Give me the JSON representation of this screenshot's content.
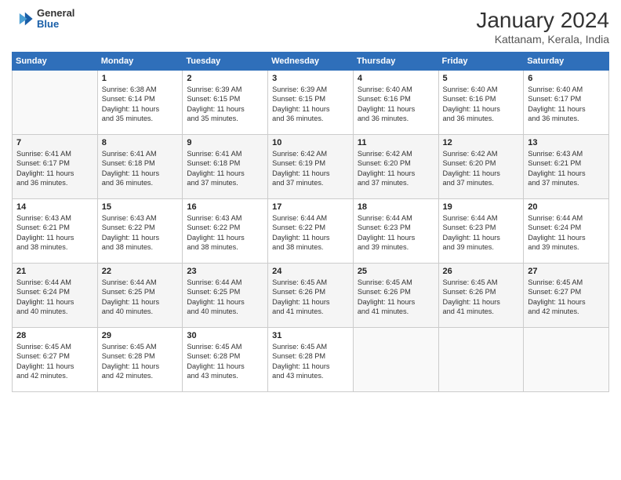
{
  "header": {
    "logo_general": "General",
    "logo_blue": "Blue",
    "month_title": "January 2024",
    "subtitle": "Kattanam, Kerala, India"
  },
  "weekdays": [
    "Sunday",
    "Monday",
    "Tuesday",
    "Wednesday",
    "Thursday",
    "Friday",
    "Saturday"
  ],
  "weeks": [
    [
      {
        "day": "",
        "info": ""
      },
      {
        "day": "1",
        "info": "Sunrise: 6:38 AM\nSunset: 6:14 PM\nDaylight: 11 hours\nand 35 minutes."
      },
      {
        "day": "2",
        "info": "Sunrise: 6:39 AM\nSunset: 6:15 PM\nDaylight: 11 hours\nand 35 minutes."
      },
      {
        "day": "3",
        "info": "Sunrise: 6:39 AM\nSunset: 6:15 PM\nDaylight: 11 hours\nand 36 minutes."
      },
      {
        "day": "4",
        "info": "Sunrise: 6:40 AM\nSunset: 6:16 PM\nDaylight: 11 hours\nand 36 minutes."
      },
      {
        "day": "5",
        "info": "Sunrise: 6:40 AM\nSunset: 6:16 PM\nDaylight: 11 hours\nand 36 minutes."
      },
      {
        "day": "6",
        "info": "Sunrise: 6:40 AM\nSunset: 6:17 PM\nDaylight: 11 hours\nand 36 minutes."
      }
    ],
    [
      {
        "day": "7",
        "info": "Sunrise: 6:41 AM\nSunset: 6:17 PM\nDaylight: 11 hours\nand 36 minutes."
      },
      {
        "day": "8",
        "info": "Sunrise: 6:41 AM\nSunset: 6:18 PM\nDaylight: 11 hours\nand 36 minutes."
      },
      {
        "day": "9",
        "info": "Sunrise: 6:41 AM\nSunset: 6:18 PM\nDaylight: 11 hours\nand 37 minutes."
      },
      {
        "day": "10",
        "info": "Sunrise: 6:42 AM\nSunset: 6:19 PM\nDaylight: 11 hours\nand 37 minutes."
      },
      {
        "day": "11",
        "info": "Sunrise: 6:42 AM\nSunset: 6:20 PM\nDaylight: 11 hours\nand 37 minutes."
      },
      {
        "day": "12",
        "info": "Sunrise: 6:42 AM\nSunset: 6:20 PM\nDaylight: 11 hours\nand 37 minutes."
      },
      {
        "day": "13",
        "info": "Sunrise: 6:43 AM\nSunset: 6:21 PM\nDaylight: 11 hours\nand 37 minutes."
      }
    ],
    [
      {
        "day": "14",
        "info": "Sunrise: 6:43 AM\nSunset: 6:21 PM\nDaylight: 11 hours\nand 38 minutes."
      },
      {
        "day": "15",
        "info": "Sunrise: 6:43 AM\nSunset: 6:22 PM\nDaylight: 11 hours\nand 38 minutes."
      },
      {
        "day": "16",
        "info": "Sunrise: 6:43 AM\nSunset: 6:22 PM\nDaylight: 11 hours\nand 38 minutes."
      },
      {
        "day": "17",
        "info": "Sunrise: 6:44 AM\nSunset: 6:22 PM\nDaylight: 11 hours\nand 38 minutes."
      },
      {
        "day": "18",
        "info": "Sunrise: 6:44 AM\nSunset: 6:23 PM\nDaylight: 11 hours\nand 39 minutes."
      },
      {
        "day": "19",
        "info": "Sunrise: 6:44 AM\nSunset: 6:23 PM\nDaylight: 11 hours\nand 39 minutes."
      },
      {
        "day": "20",
        "info": "Sunrise: 6:44 AM\nSunset: 6:24 PM\nDaylight: 11 hours\nand 39 minutes."
      }
    ],
    [
      {
        "day": "21",
        "info": "Sunrise: 6:44 AM\nSunset: 6:24 PM\nDaylight: 11 hours\nand 40 minutes."
      },
      {
        "day": "22",
        "info": "Sunrise: 6:44 AM\nSunset: 6:25 PM\nDaylight: 11 hours\nand 40 minutes."
      },
      {
        "day": "23",
        "info": "Sunrise: 6:44 AM\nSunset: 6:25 PM\nDaylight: 11 hours\nand 40 minutes."
      },
      {
        "day": "24",
        "info": "Sunrise: 6:45 AM\nSunset: 6:26 PM\nDaylight: 11 hours\nand 41 minutes."
      },
      {
        "day": "25",
        "info": "Sunrise: 6:45 AM\nSunset: 6:26 PM\nDaylight: 11 hours\nand 41 minutes."
      },
      {
        "day": "26",
        "info": "Sunrise: 6:45 AM\nSunset: 6:26 PM\nDaylight: 11 hours\nand 41 minutes."
      },
      {
        "day": "27",
        "info": "Sunrise: 6:45 AM\nSunset: 6:27 PM\nDaylight: 11 hours\nand 42 minutes."
      }
    ],
    [
      {
        "day": "28",
        "info": "Sunrise: 6:45 AM\nSunset: 6:27 PM\nDaylight: 11 hours\nand 42 minutes."
      },
      {
        "day": "29",
        "info": "Sunrise: 6:45 AM\nSunset: 6:28 PM\nDaylight: 11 hours\nand 42 minutes."
      },
      {
        "day": "30",
        "info": "Sunrise: 6:45 AM\nSunset: 6:28 PM\nDaylight: 11 hours\nand 43 minutes."
      },
      {
        "day": "31",
        "info": "Sunrise: 6:45 AM\nSunset: 6:28 PM\nDaylight: 11 hours\nand 43 minutes."
      },
      {
        "day": "",
        "info": ""
      },
      {
        "day": "",
        "info": ""
      },
      {
        "day": "",
        "info": ""
      }
    ]
  ]
}
